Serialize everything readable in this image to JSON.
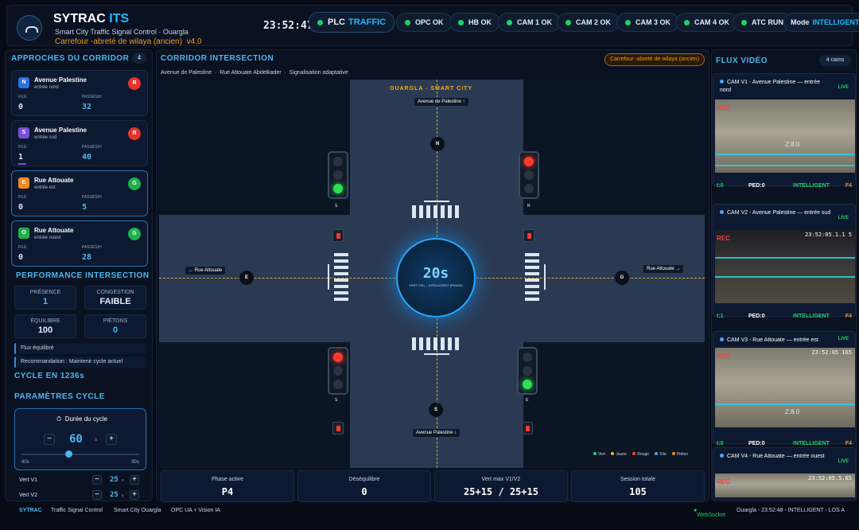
{
  "header": {
    "brand_a": "SYTRAC",
    "brand_b": "ITS",
    "subtitle": "Smart City Traffic Signal Control · Ouargla",
    "site": "Carrefour -abreté de wilaya (ancien)",
    "version": "v4.0",
    "clock": "23:52:47"
  },
  "status_pills": [
    {
      "label": "PLC",
      "value": "TRAFFIC"
    },
    {
      "label": "OPC OK"
    },
    {
      "label": "HB OK"
    },
    {
      "label": "CAM 1 OK"
    },
    {
      "label": "CAM 2 OK"
    },
    {
      "label": "CAM 3 OK"
    },
    {
      "label": "CAM 4 OK"
    },
    {
      "label": "ATC RUN"
    }
  ],
  "mode": {
    "label": "Mode",
    "value": "INTELLIGENT"
  },
  "approaches": {
    "title": "APPROCHES DU CORRIDOR",
    "count": "4",
    "file_label": "FILE",
    "pass_label": "PASSÉS/H",
    "items": [
      {
        "icon": "N",
        "name": "Avenue Palestine",
        "desc": "entrée nord",
        "state": "R",
        "file": "0",
        "pass": "32"
      },
      {
        "icon": "S",
        "name": "Avenue Palestine",
        "desc": "entrée sud",
        "state": "R",
        "file": "1",
        "pass": "40"
      },
      {
        "icon": "E",
        "name": "Rue Attouate",
        "desc": "entrée est",
        "state": "G",
        "file": "0",
        "pass": "5"
      },
      {
        "icon": "O",
        "name": "Rue Attouate",
        "desc": "entrée ouest",
        "state": "G",
        "file": "0",
        "pass": "28"
      }
    ]
  },
  "performance": {
    "title": "PERFORMANCE INTERSECTION",
    "kpis": [
      {
        "k": "PRÉSENCE",
        "v": "1"
      },
      {
        "k": "CONGESTION",
        "v": "FAIBLE"
      },
      {
        "k": "ÉQUILIBRE",
        "v": "100"
      },
      {
        "k": "PIÉTONS",
        "v": "0"
      }
    ],
    "notes": [
      "Flux équilibré",
      "Recommandation : Maintenir cycle actuel"
    ]
  },
  "cycle": {
    "title": "CYCLE EN 1236s",
    "params_title": "PARAMÈTRES CYCLE",
    "duration_label": "Durée du cycle",
    "value": "60",
    "unit": "s",
    "min": "40s",
    "max": "90s",
    "level": 0.4,
    "vert": [
      {
        "label": "Vert V1",
        "value": "25",
        "unit": "s"
      },
      {
        "label": "Vert V2",
        "value": "25",
        "unit": "s"
      }
    ]
  },
  "corridor": {
    "title": "CORRIDOR INTERSECTION",
    "badge": "Carrefour -abreté de wilaya (ancien)",
    "crumbs": [
      "Avenue de Palestine",
      "Rue Attouate Abdelkader",
      "Signalisation adaptative"
    ],
    "city": "OUARGLA - SMART CITY",
    "timer": "20s",
    "timer_sub": "VERT CIS₁ -- INTELLIGENT (PHASE)",
    "labels": {
      "north": "Avenue de Palestine ↑",
      "south": "Avenue Palestine ↓",
      "west": "← Rue Attouate",
      "east": "Rue Attouate →"
    },
    "nodes": {
      "n": "N",
      "s": "S",
      "e": "E",
      "g": "G"
    },
    "signal_tags": {
      "s1": "S",
      "r": "R",
      "s2": "S",
      "e": "E"
    },
    "legend": [
      "Vert",
      "Jaune",
      "Rouge",
      "File",
      "Piéton"
    ]
  },
  "stats": [
    {
      "k": "Phase active",
      "v": "P4"
    },
    {
      "k": "Déséquilibre",
      "v": "0"
    },
    {
      "k": "Vert max V1/V2",
      "v": "25+15 / 25+15"
    },
    {
      "k": "Session totale",
      "v": "105"
    }
  ],
  "video": {
    "title": "FLUX VIDÉO",
    "count": "4 cams",
    "cams": [
      {
        "title": "CAM V1 - Avenue Palestine — entrée nord",
        "live": "LIVE",
        "rec": "REC",
        "ts": "",
        "z": "Z:8.0",
        "t": "t:0",
        "ped": "PED:0",
        "mode": "INTELLIGENT",
        "f": "F4"
      },
      {
        "title": "CAM V2 - Avenue Palestine — entrée sud",
        "live": "LIVE",
        "rec": "REC",
        "ts": "23:52:05.1.1 5",
        "z": "",
        "t": "t:1",
        "ped": "PED:0",
        "mode": "INTELLIGENT",
        "f": "F4"
      },
      {
        "title": "CAM V3 - Rue Attouate — entrée est",
        "live": "LIVE",
        "rec": "REC",
        "ts": "23:52:05 165",
        "z": "Z:8.0",
        "t": "t:0",
        "ped": "PED:0",
        "mode": "INTELLIGENT",
        "f": "F4"
      },
      {
        "title": "CAM V4 - Rue Attouate — entrée ouest",
        "live": "LIVE",
        "rec": "REC",
        "ts": "23:52:05.5.65",
        "z": "",
        "t": "",
        "ped": "",
        "mode": "",
        "f": ""
      }
    ]
  },
  "footer": {
    "brand": "SYTRAC",
    "items": [
      "Traffic Signal Control",
      "Smart City Ouargla",
      "OPC UA + Vision IA"
    ],
    "ws": "WebSocket",
    "right": "Ouargla - 23:52:48 - INTELLIGENT - LOS A"
  },
  "colors": {
    "accent": "#22b8ff",
    "green": "#20d26a",
    "red": "#ff3a2a",
    "orange": "#f39a1e"
  }
}
